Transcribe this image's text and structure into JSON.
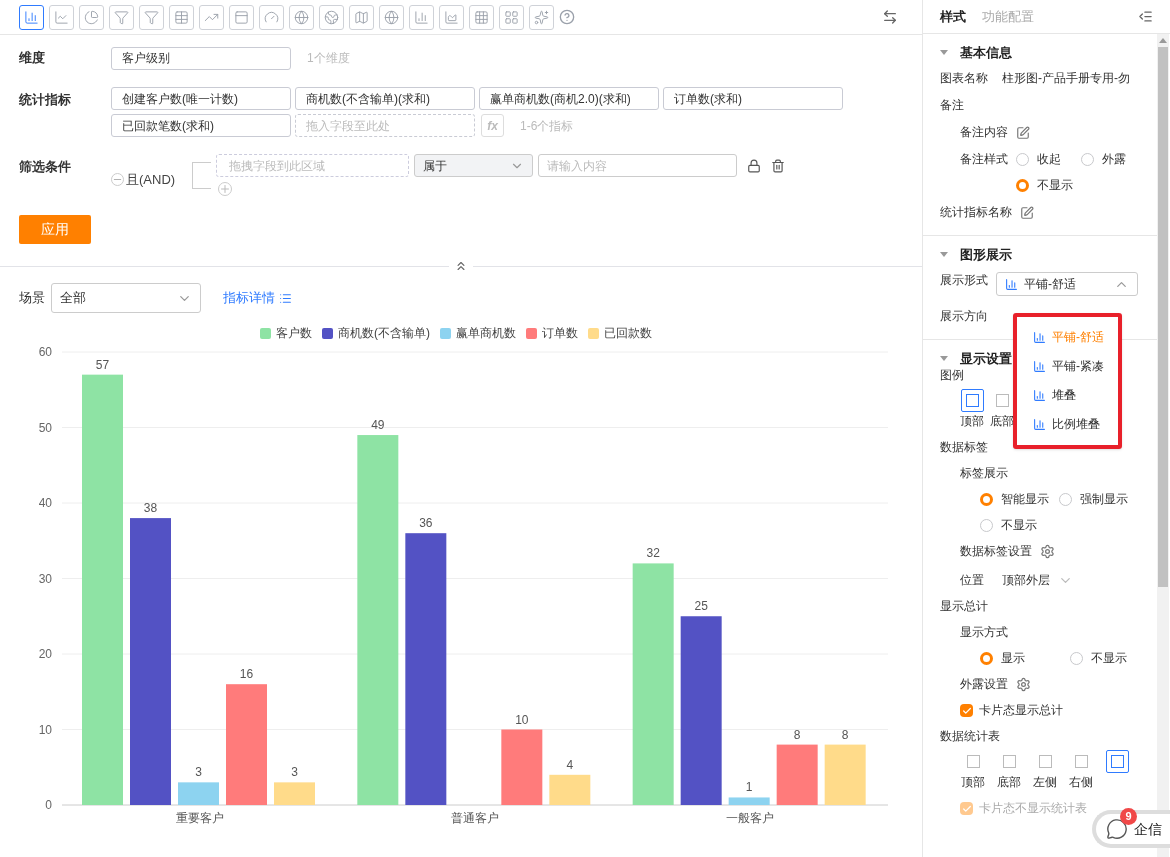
{
  "toolbar": {
    "chart_types": [
      {
        "selected": true
      },
      {
        "selected": false
      },
      {
        "selected": false
      },
      {
        "selected": false
      },
      {
        "selected": false
      },
      {
        "selected": false
      },
      {
        "selected": false
      },
      {
        "selected": false
      },
      {
        "selected": false
      },
      {
        "selected": false
      },
      {
        "selected": false
      },
      {
        "selected": false
      },
      {
        "selected": false
      },
      {
        "selected": false
      },
      {
        "selected": false
      },
      {
        "selected": false
      },
      {
        "selected": false
      },
      {
        "selected": false
      }
    ]
  },
  "config": {
    "dimension": {
      "label": "维度",
      "fields": [
        "客户级别"
      ],
      "hint": "1个维度"
    },
    "metrics": {
      "label": "统计指标",
      "fields": [
        "创建客户数(唯一计数)",
        "商机数(不含输单)(求和)",
        "赢单商机数(商机2.0)(求和)",
        "订单数(求和)",
        "已回款笔数(求和)"
      ],
      "placeholder": "拖入字段至此处",
      "formula": "fx",
      "hint": "1-6个指标"
    },
    "filter": {
      "label": "筛选条件",
      "logic": "且(AND)",
      "field_placeholder": "拖拽字段到此区域",
      "operator": "属于",
      "value_placeholder": "请输入内容"
    },
    "apply": "应用"
  },
  "scene": {
    "label": "场景",
    "value": "全部",
    "details": "指标详情"
  },
  "chart": {
    "chart_data": {
      "type": "bar",
      "categories": [
        "重要客户",
        "普通客户",
        "一般客户"
      ],
      "series": [
        {
          "name": "客户数",
          "color": "#8ee3a4",
          "values": [
            57,
            49,
            32
          ]
        },
        {
          "name": "商机数(不含输单)",
          "color": "#5352c4",
          "values": [
            38,
            36,
            25
          ]
        },
        {
          "name": "赢单商机数",
          "color": "#8dd3f0",
          "values": [
            3,
            null,
            1
          ]
        },
        {
          "name": "订单数",
          "color": "#ff7b7b",
          "values": [
            16,
            10,
            8
          ]
        },
        {
          "name": "已回款数",
          "color": "#ffdb8a",
          "values": [
            3,
            4,
            8
          ]
        }
      ],
      "ylim": [
        0,
        60
      ],
      "grid": true,
      "yticks": [
        0,
        10,
        20,
        30,
        40,
        50,
        60
      ],
      "data_labels": true
    }
  },
  "panel": {
    "tabs": [
      {
        "label": "样式",
        "selected": true
      },
      {
        "label": "功能配置",
        "selected": false
      }
    ],
    "basic": {
      "title": "基本信息",
      "name_label": "图表名称",
      "name_value": "柱形图-产品手册专用-勿",
      "note": "备注",
      "note_content": "备注内容",
      "note_style": "备注样式",
      "note_options": [
        {
          "label": "收起",
          "selected": false
        },
        {
          "label": "外露",
          "selected": false
        },
        {
          "label": "不显示",
          "selected": true
        }
      ],
      "metric_name": "统计指标名称"
    },
    "graphic": {
      "title": "图形展示",
      "form_label": "展示形式",
      "form_value": "平铺-舒适",
      "open": true,
      "options": [
        {
          "label": "平铺-舒适",
          "selected": true
        },
        {
          "label": "平铺-紧凑",
          "selected": false
        },
        {
          "label": "堆叠",
          "selected": false
        },
        {
          "label": "比例堆叠",
          "selected": false
        }
      ],
      "direction_label": "展示方向"
    },
    "display": {
      "title": "显示设置",
      "legend_label": "图例",
      "legend_positions": [
        {
          "label": "顶部",
          "selected": true
        },
        {
          "label": "底部",
          "selected": false
        }
      ],
      "data_label": "数据标签",
      "label_show": "标签展示",
      "label_options": [
        {
          "label": "智能显示",
          "selected": true
        },
        {
          "label": "强制显示",
          "selected": false
        },
        {
          "label": "不显示",
          "selected": false
        }
      ],
      "label_settings": "数据标签设置",
      "position_label": "位置",
      "position_value": "顶部外层",
      "total": "显示总计",
      "total_mode": "显示方式",
      "total_options": [
        {
          "label": "显示",
          "selected": true
        },
        {
          "label": "不显示",
          "selected": false
        }
      ],
      "expose_settings": "外露设置",
      "card_total": {
        "label": "卡片态显示总计",
        "checked": true,
        "disabled": false
      },
      "table_label": "数据统计表",
      "table_positions": [
        {
          "label": "顶部",
          "selected": false
        },
        {
          "label": "底部",
          "selected": false
        },
        {
          "label": "左侧",
          "selected": false
        },
        {
          "label": "右侧",
          "selected": false
        },
        {
          "selected": true
        }
      ],
      "card_table": {
        "label": "卡片态不显示统计表",
        "checked": true,
        "disabled": true
      }
    }
  },
  "chat": {
    "label": "企信",
    "badge": "9"
  }
}
